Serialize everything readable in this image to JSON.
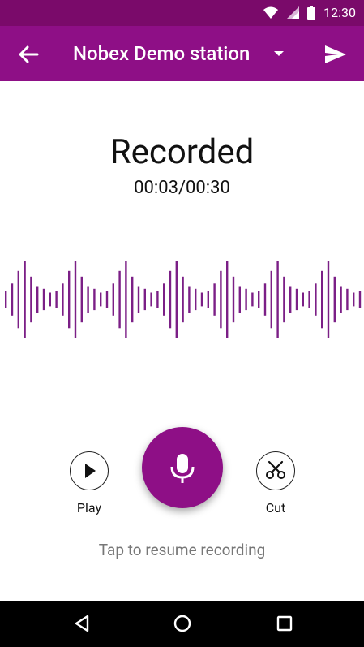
{
  "status_bar": {
    "time": "12:30",
    "icons": [
      "wifi-icon",
      "cellular-icon",
      "battery-icon"
    ]
  },
  "app_bar": {
    "title": "Nobex Demo station",
    "back_icon": "arrow-left-icon",
    "dropdown_icon": "caret-down-icon",
    "send_icon": "send-icon",
    "background": "#8e0f86"
  },
  "recording": {
    "status": "Recorded",
    "elapsed": "00:03",
    "max": "00:30",
    "timer_text": "00:03/00:30"
  },
  "controls": {
    "play_label": "Play",
    "cut_label": "Cut",
    "mic_icon": "microphone-icon",
    "accent": "#8e0f86"
  },
  "hint": "Tap to resume recording",
  "nav": [
    "back-triangle-icon",
    "home-circle-icon",
    "recents-square-icon"
  ],
  "waveform_color": "#7b1f86"
}
